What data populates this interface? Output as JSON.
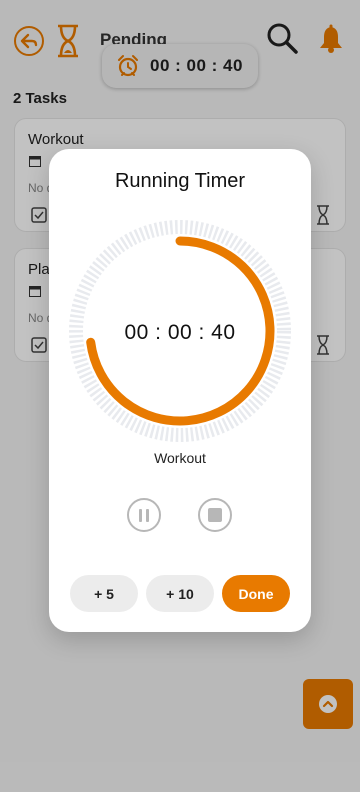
{
  "header": {
    "title": "Pending",
    "timer_display": "00 : 00 : 40"
  },
  "task_count": "2 Tasks",
  "tasks": [
    {
      "title": "Workout",
      "note": "No d"
    },
    {
      "title": "Pla",
      "note": "No d"
    }
  ],
  "dialog": {
    "title": "Running Timer",
    "time": "00 : 00 : 40",
    "task_name": "Workout",
    "progress": 0.73,
    "buttons": {
      "plus5": "+ 5",
      "plus10": "+ 10",
      "done": "Done"
    }
  },
  "colors": {
    "accent": "#e87a00",
    "ring_track": "#e8eaee",
    "control_grey": "#b7b7b7"
  },
  "icons": {
    "back": "back-arrow-icon",
    "hourglass": "hourglass-icon",
    "search": "search-icon",
    "bell": "bell-icon",
    "alarm": "alarm-clock-icon",
    "scroll_up": "chevron-up-icon"
  }
}
